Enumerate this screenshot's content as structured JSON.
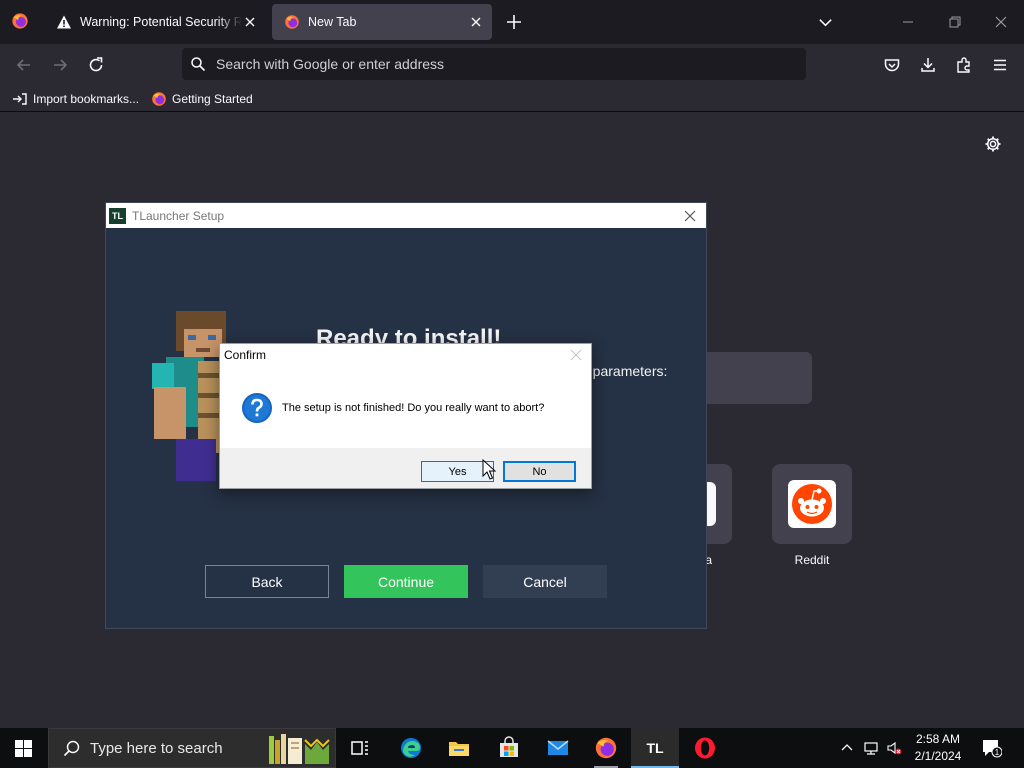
{
  "browser": {
    "tabs": [
      {
        "label": "Warning: Potential Security Risk Ahead",
        "icon": "warning-icon",
        "active": false
      },
      {
        "label": "New Tab",
        "icon": "firefox-icon",
        "active": true
      }
    ],
    "urlbar": {
      "placeholder": "Search with Google or enter address"
    },
    "bookmarks": [
      {
        "label": "Import bookmarks...",
        "icon": "import-icon"
      },
      {
        "label": "Getting Started",
        "icon": "firefox-icon"
      }
    ],
    "colors": {
      "chrome": "#1c1b22",
      "toolbar": "#2b2a33",
      "active_tab": "#42414d"
    }
  },
  "newtab": {
    "shortcuts": [
      {
        "label": "lia",
        "icon": "wikipedia-icon"
      },
      {
        "label": "Reddit",
        "icon": "reddit-icon"
      }
    ]
  },
  "tlauncher": {
    "window_title": "TLauncher Setup",
    "icon_text": "TL",
    "heading": "Ready to install!",
    "param_text": "e parameters:",
    "buttons": {
      "back": "Back",
      "continue": "Continue",
      "cancel": "Cancel"
    },
    "colors": {
      "background": "#253144",
      "continue": "#33c45b",
      "cancel": "#323e52"
    }
  },
  "dialog": {
    "title": "Confirm",
    "message": "The setup is not finished! Do you really want to abort?",
    "buttons": {
      "yes": "Yes",
      "no": "No"
    },
    "icon": "question-icon"
  },
  "taskbar": {
    "search_placeholder": "Type here to search",
    "apps": [
      "task-view-icon",
      "edge-icon",
      "file-explorer-icon",
      "store-icon",
      "mail-icon",
      "firefox-icon",
      "tlauncher-icon",
      "opera-icon"
    ],
    "tl_label": "TL",
    "clock": {
      "time": "2:58 AM",
      "date": "2/1/2024"
    },
    "notification_count": "1"
  }
}
